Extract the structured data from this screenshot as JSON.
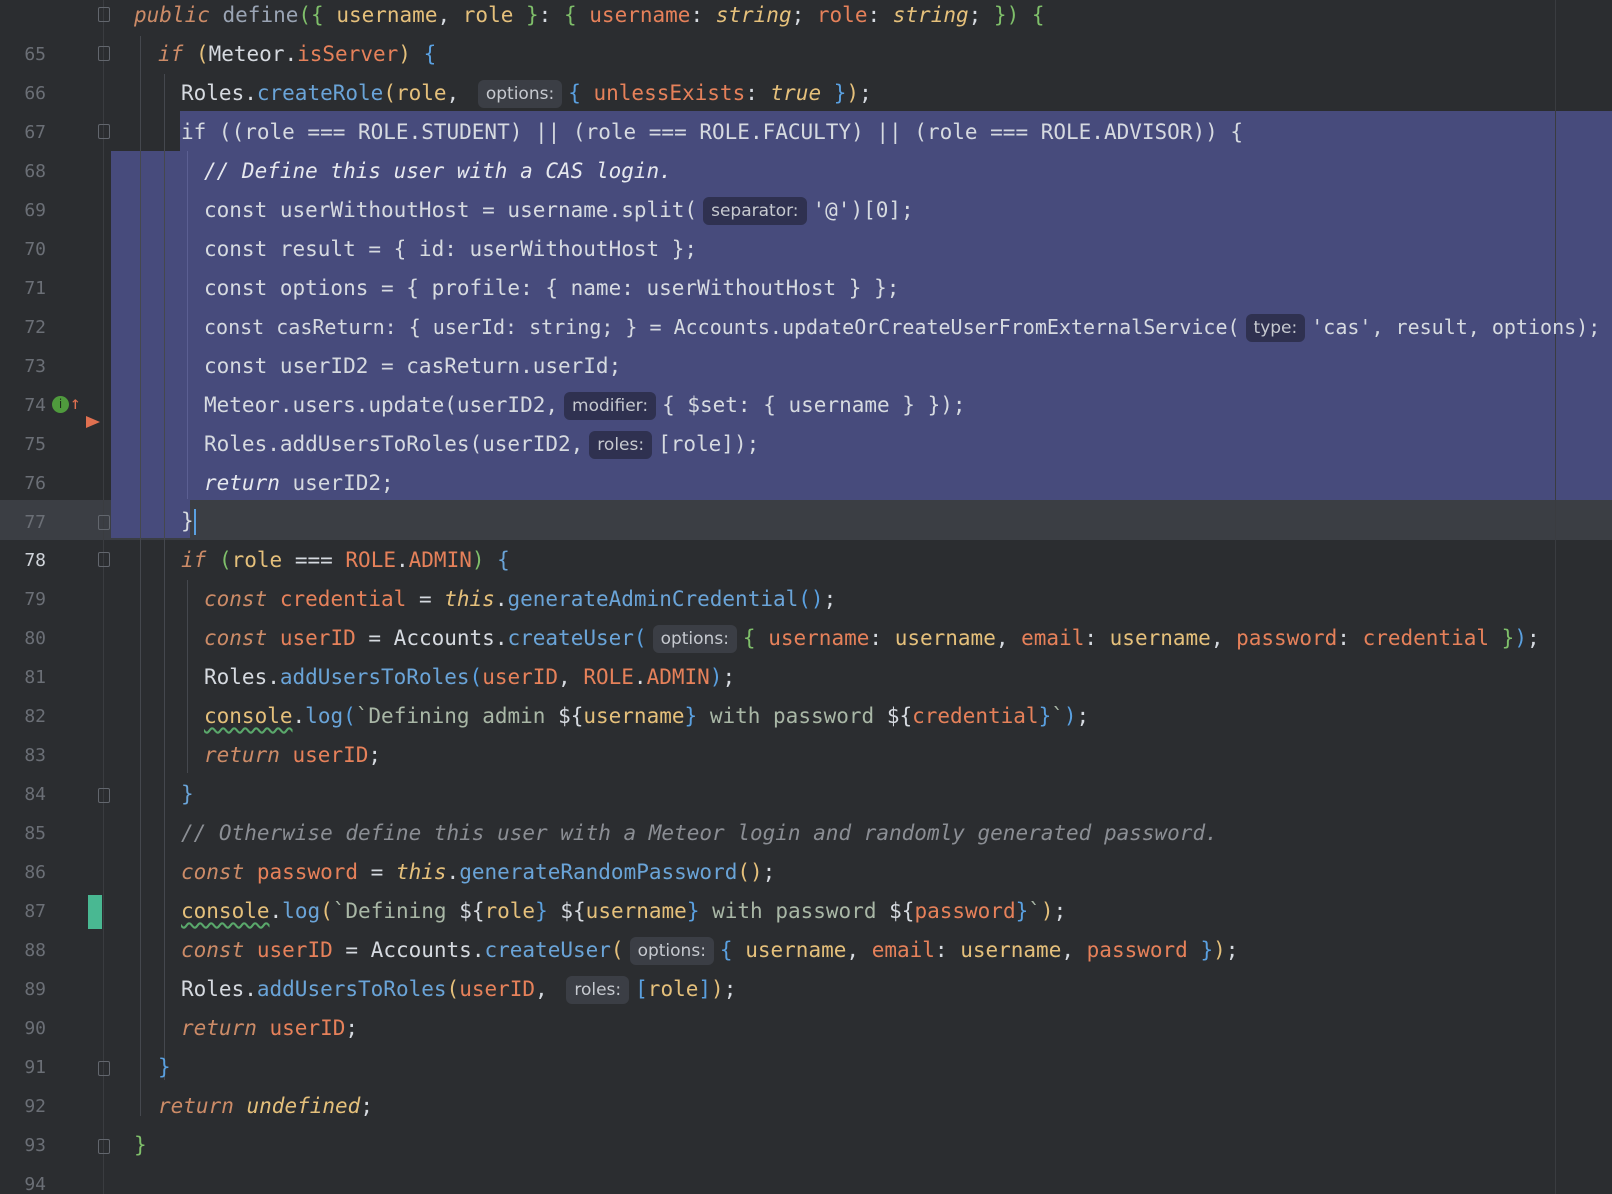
{
  "editor": {
    "current_line": 78,
    "lines": [
      {
        "no": "65"
      },
      {
        "no": "66"
      },
      {
        "no": "67"
      },
      {
        "no": "68"
      },
      {
        "no": "69"
      },
      {
        "no": "70"
      },
      {
        "no": "71"
      },
      {
        "no": "72"
      },
      {
        "no": "73"
      },
      {
        "no": "74"
      },
      {
        "no": "75"
      },
      {
        "no": "76"
      },
      {
        "no": "77"
      },
      {
        "no": "78"
      },
      {
        "no": "79"
      },
      {
        "no": "80"
      },
      {
        "no": "81"
      },
      {
        "no": "82"
      },
      {
        "no": "83"
      },
      {
        "no": "84"
      },
      {
        "no": "85"
      },
      {
        "no": "86"
      },
      {
        "no": "87"
      },
      {
        "no": "88"
      },
      {
        "no": "89"
      },
      {
        "no": "90"
      },
      {
        "no": "91"
      },
      {
        "no": "92"
      },
      {
        "no": "93"
      },
      {
        "no": "94"
      }
    ],
    "hints": {
      "options": "options:",
      "separator": "separator:",
      "type": "type:",
      "modifier": "modifier:",
      "roles": "roles:"
    },
    "code": {
      "l65": "public define({ username, role }: { username: string; role: string; }) {",
      "l66": "if (Meteor.isServer) {",
      "l67a": "Roles.createRole(role,",
      "l67b": "{ unlessExists: true });",
      "l68": "if ((role === ROLE.STUDENT) || (role === ROLE.FACULTY) || (role === ROLE.ADVISOR)) {",
      "l69": "// Define this user with a CAS login.",
      "l70a": "const userWithoutHost = username.split(",
      "l70b": "'@')[0];",
      "l71": "const result = { id: userWithoutHost };",
      "l72": "const options = { profile: { name: userWithoutHost } };",
      "l73a": "const casReturn: { userId: string; } = Accounts.updateOrCreateUserFromExternalService(",
      "l73b": "'cas', result, options);",
      "l74": "const userID2 = casReturn.userId;",
      "l75a": "Meteor.users.update(userID2,",
      "l75b": "{ $set: { username } });",
      "l76a": "Roles.addUsersToRoles(userID2,",
      "l76b": "[role]);",
      "l77": "return userID2;",
      "l78": "}",
      "l79": "if (role === ROLE.ADMIN) {",
      "l80": "const credential = this.generateAdminCredential();",
      "l81a": "const userID = Accounts.createUser(",
      "l81b": "{ username: username, email: username, password: credential });",
      "l82": "Roles.addUsersToRoles(userID, ROLE.ADMIN);",
      "l83": "console.log(`Defining admin ${username} with password ${credential}`);",
      "l84": "return userID;",
      "l85": "}",
      "l86": "// Otherwise define this user with a Meteor login and randomly generated password.",
      "l87": "const password = this.generateRandomPassword();",
      "l88": "console.log(`Defining ${role} ${username} with password ${password}`);",
      "l89a": "const userID = Accounts.createUser(",
      "l89b": "{ username, email: username, password });",
      "l90a": "Roles.addUsersToRoles(userID,",
      "l90b": "[role]);",
      "l91": "return userID;",
      "l92": "}",
      "l93": "return undefined;",
      "l94": "}"
    }
  }
}
